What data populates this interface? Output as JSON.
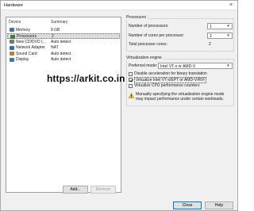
{
  "window": {
    "title": "Hardware",
    "close_glyph": "×"
  },
  "devices": {
    "columns": {
      "device": "Device",
      "summary": "Summary"
    },
    "rows": [
      {
        "name": "Memory",
        "summary": "8 GB",
        "icon": "memory-icon",
        "color": "#4a6fa5"
      },
      {
        "name": "Processors",
        "summary": "2",
        "icon": "processor-icon",
        "color": "#3c7d3c"
      },
      {
        "name": "New CD/DVD (...",
        "summary": "Auto detect",
        "icon": "cd-dvd-icon",
        "color": "#777777"
      },
      {
        "name": "Network Adapter",
        "summary": "NAT",
        "icon": "network-adapter-icon",
        "color": "#2f6db5"
      },
      {
        "name": "Sound Card",
        "summary": "Auto detect",
        "icon": "sound-card-icon",
        "color": "#b5862f"
      },
      {
        "name": "Display",
        "summary": "Auto detect",
        "icon": "display-icon",
        "color": "#3a78c2"
      }
    ],
    "selected_index": 1,
    "add_label": "Add...",
    "remove_label": "Remove"
  },
  "processors": {
    "title": "Processors",
    "num_processors_label": "Number of processors:",
    "num_processors_value": "1",
    "cores_label": "Number of cores per processor:",
    "cores_value": "2",
    "total_label": "Total processor cores:",
    "total_value": "2"
  },
  "virtualization": {
    "title": "Virtualization engine",
    "mode_label": "Preferred mode:",
    "mode_value": "Intel VT-x or AMD-V",
    "options": [
      {
        "label": "Disable acceleration for binary translation",
        "checked": false
      },
      {
        "label": "Virtualize Intel VT-x/EPT or AMD-V/RVI",
        "checked": true
      },
      {
        "label": "Virtualize CPU performance counters",
        "checked": false
      }
    ],
    "warning": "Manually specifying the virtualization engine mode may impact performance under certain workloads.",
    "warning_icon": "warning-icon"
  },
  "footer": {
    "close_label": "Close",
    "help_label": "Help"
  },
  "watermark": "https://arkit.co.in",
  "colors": {
    "accent": "#0078d7",
    "warning": "#f2c811",
    "selection": "#dcdcdc"
  }
}
